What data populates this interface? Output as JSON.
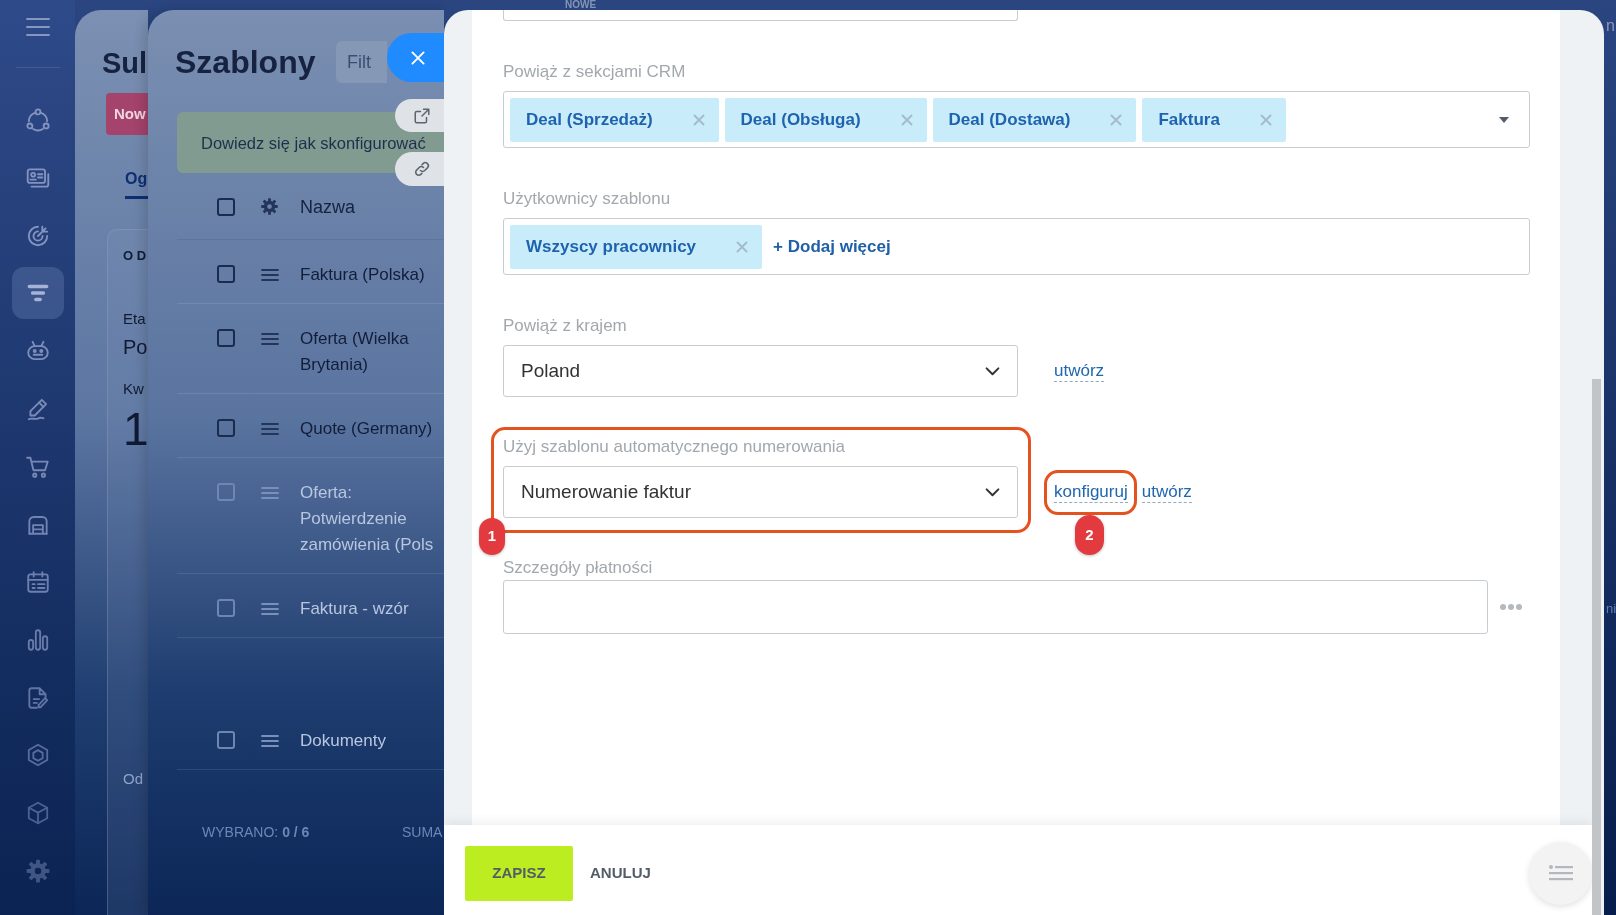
{
  "background_label": "NOWE",
  "sidebar": {
    "items": [
      {
        "selected": false
      },
      {
        "selected": false
      },
      {
        "selected": false
      },
      {
        "selected": true
      },
      {
        "selected": false
      },
      {
        "selected": false
      },
      {
        "selected": false
      },
      {
        "selected": false
      },
      {
        "selected": false
      },
      {
        "selected": false
      },
      {
        "selected": false
      },
      {
        "selected": false
      },
      {
        "selected": false
      },
      {
        "selected": false
      }
    ]
  },
  "deal_panel": {
    "title": "Sul",
    "new_button": "Now",
    "tabs": [
      {
        "label": "Og",
        "selected": true
      }
    ],
    "card": {
      "title": "O D",
      "stage_label": "Eta",
      "stage_value": "Po",
      "amount_label": "Kw",
      "amount_value": "1",
      "footer_label": "Od"
    }
  },
  "templates_panel": {
    "title": "Szablony",
    "filter": {
      "placeholder": "Filt"
    },
    "banner": "Dowiedz się jak skonfigurować",
    "table": {
      "select_all": {
        "checked": false
      },
      "columns": [
        "Nazwa"
      ],
      "rows": [
        {
          "name": "Faktura (Polska)",
          "checked": false
        },
        {
          "name": "Oferta (Wielka Brytania)",
          "checked": false
        },
        {
          "name": "Quote (Germany)",
          "checked": false
        },
        {
          "name": "Oferta: Potwierdzenie zamówienia (Pols",
          "checked": false
        },
        {
          "name": "Faktura - wzór",
          "checked": false
        },
        {
          "name": "Dokumenty",
          "checked": false
        }
      ]
    },
    "footer": {
      "selected": "WYBRANO: **0 / 6**",
      "sum_label": "SUMA"
    }
  },
  "form": {
    "fields": [
      {
        "kind": "tags",
        "label": "Powiąż z sekcjami CRM",
        "tags": [
          "Deal (Sprzedaż)",
          "Deal (Obsługa)",
          "Deal (Dostawa)",
          "Faktura"
        ],
        "dropdown": true
      },
      {
        "kind": "tags",
        "label": "Użytkownicy szablonu",
        "tags": [
          "Wszyscy pracownicy"
        ],
        "add_link": "+ Dodaj więcej"
      },
      {
        "kind": "select",
        "label": "Powiąż z krajem",
        "value": "Poland",
        "links": [
          {
            "text": "utwórz"
          }
        ]
      },
      {
        "kind": "select",
        "label": "Użyj szablonu automatycznego numerowania",
        "value": "Numerowanie faktur",
        "annotation": {
          "label": "1"
        },
        "links": [
          {
            "text": "konfiguruj",
            "annotation": {
              "label": "2"
            }
          },
          {
            "text": "utwórz"
          }
        ]
      },
      {
        "kind": "textarea",
        "label": "Szczegóły płatności"
      }
    ]
  },
  "footer": {
    "buttons": [
      {
        "label": "ZAPISZ",
        "kind": "primary"
      },
      {
        "label": "ANULUJ",
        "kind": "link"
      }
    ]
  },
  "edge_fragments": [
    {
      "text": "n"
    },
    {
      "text": "ni"
    }
  ]
}
